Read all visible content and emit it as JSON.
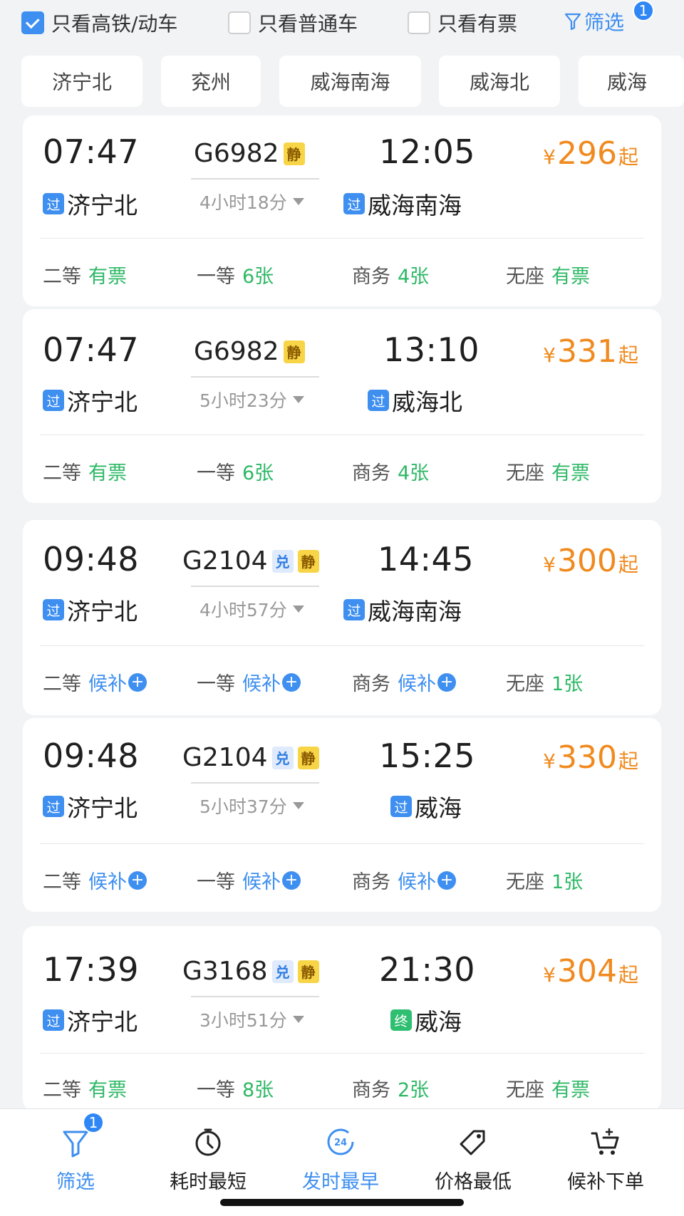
{
  "filters": {
    "only_hsr": {
      "label": "只看高铁/动车",
      "checked": true
    },
    "only_normal": {
      "label": "只看普通车",
      "checked": false
    },
    "only_available": {
      "label": "只看有票",
      "checked": false
    },
    "filter_label": "筛选",
    "filter_badge": "1"
  },
  "stations": [
    "济宁北",
    "兖州",
    "威海南海",
    "威海北",
    "威海"
  ],
  "trains": [
    {
      "depart_time": "07:47",
      "train_no": "G6982",
      "tags": [
        "静"
      ],
      "duration": "4小时18分",
      "arrive_time": "12:05",
      "from_mark": "过",
      "from": "济宁北",
      "to_mark": "过",
      "to": "威海南海",
      "currency": "¥",
      "price": "296",
      "price_suffix": "起",
      "seats": [
        {
          "cls": "二等",
          "status": "有票"
        },
        {
          "cls": "一等",
          "status": "6张"
        },
        {
          "cls": "商务",
          "status": "4张"
        },
        {
          "cls": "无座",
          "status": "有票"
        }
      ]
    },
    {
      "depart_time": "07:47",
      "train_no": "G6982",
      "tags": [
        "静"
      ],
      "duration": "5小时23分",
      "arrive_time": "13:10",
      "from_mark": "过",
      "from": "济宁北",
      "to_mark": "过",
      "to": "威海北",
      "currency": "¥",
      "price": "331",
      "price_suffix": "起",
      "seats": [
        {
          "cls": "二等",
          "status": "有票"
        },
        {
          "cls": "一等",
          "status": "6张"
        },
        {
          "cls": "商务",
          "status": "4张"
        },
        {
          "cls": "无座",
          "status": "有票"
        }
      ]
    },
    {
      "depart_time": "09:48",
      "train_no": "G2104",
      "tags": [
        "兑",
        "静"
      ],
      "duration": "4小时57分",
      "arrive_time": "14:45",
      "from_mark": "过",
      "from": "济宁北",
      "to_mark": "过",
      "to": "威海南海",
      "currency": "¥",
      "price": "300",
      "price_suffix": "起",
      "seats": [
        {
          "cls": "二等",
          "status": "候补"
        },
        {
          "cls": "一等",
          "status": "候补"
        },
        {
          "cls": "商务",
          "status": "候补"
        },
        {
          "cls": "无座",
          "status": "1张"
        }
      ]
    },
    {
      "depart_time": "09:48",
      "train_no": "G2104",
      "tags": [
        "兑",
        "静"
      ],
      "duration": "5小时37分",
      "arrive_time": "15:25",
      "from_mark": "过",
      "from": "济宁北",
      "to_mark": "过",
      "to": "威海",
      "currency": "¥",
      "price": "330",
      "price_suffix": "起",
      "seats": [
        {
          "cls": "二等",
          "status": "候补"
        },
        {
          "cls": "一等",
          "status": "候补"
        },
        {
          "cls": "商务",
          "status": "候补"
        },
        {
          "cls": "无座",
          "status": "1张"
        }
      ]
    },
    {
      "depart_time": "17:39",
      "train_no": "G3168",
      "tags": [
        "兑",
        "静"
      ],
      "duration": "3小时51分",
      "arrive_time": "21:30",
      "from_mark": "过",
      "from": "济宁北",
      "to_mark": "终",
      "to": "威海",
      "currency": "¥",
      "price": "304",
      "price_suffix": "起",
      "seats": [
        {
          "cls": "二等",
          "status": "有票"
        },
        {
          "cls": "一等",
          "status": "8张"
        },
        {
          "cls": "商务",
          "status": "2张"
        },
        {
          "cls": "无座",
          "status": "有票"
        }
      ]
    }
  ],
  "tabbar": {
    "filter": {
      "label": "筛选",
      "badge": "1"
    },
    "shortest": {
      "label": "耗时最短"
    },
    "earliest": {
      "label": "发时最早",
      "icon_text": "24"
    },
    "cheapest": {
      "label": "价格最低"
    },
    "waitlist": {
      "label": "候补下单"
    }
  },
  "colors": {
    "accent": "#3e8ff0",
    "price": "#f08a1e",
    "available": "#2eb866",
    "tag_quiet": "#f7d547"
  }
}
